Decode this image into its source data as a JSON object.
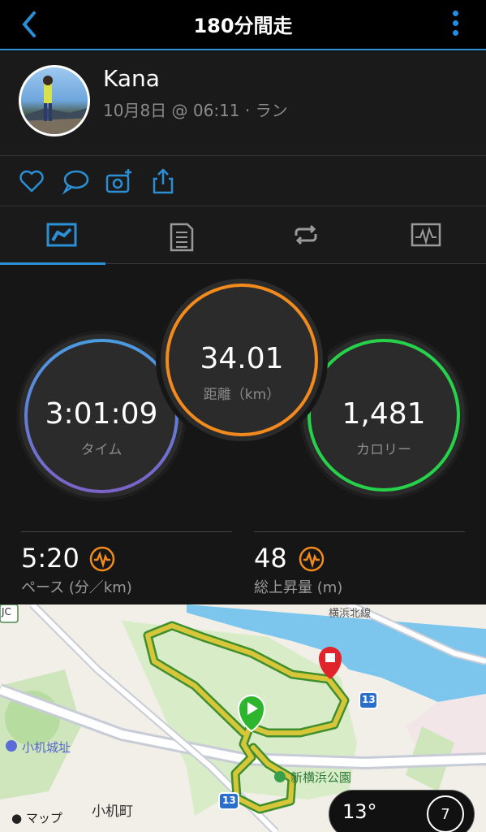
{
  "header": {
    "title": "180分間走"
  },
  "profile": {
    "name": "Kana",
    "meta": "10月8日 @ 06:11 · ラン"
  },
  "stats": {
    "distance": {
      "value": "34.01",
      "label": "距離（km）"
    },
    "time": {
      "value": "3:01:09",
      "label": "タイム"
    },
    "calories": {
      "value": "1,481",
      "label": "カロリー"
    },
    "pace": {
      "value": "5:20",
      "label": "ペース (分／km)"
    },
    "elevation": {
      "value": "48",
      "label": "総上昇量 (m)"
    }
  },
  "map": {
    "labels": {
      "castle": "小机城址",
      "town": "小机町",
      "park": "新横浜公園",
      "road": "横浜北線",
      "jc": "JC",
      "route13a": "13",
      "route13b": "13",
      "attribution": "マップ"
    },
    "weather": {
      "temperature": "13°",
      "wind": "7"
    }
  },
  "colors": {
    "accent": "#2b8fd6",
    "time_ring": "#5b7fdc",
    "distance_ring": "#f28a1e",
    "calorie_ring": "#25d24a",
    "metric_icon": "#f28a1e"
  }
}
